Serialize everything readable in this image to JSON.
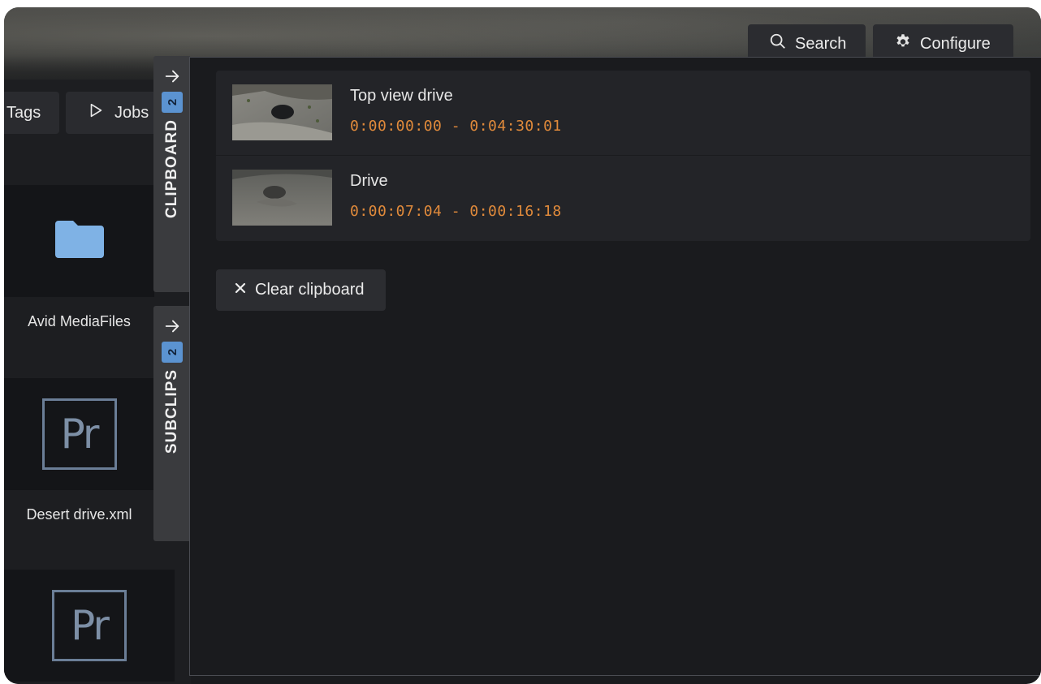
{
  "header": {
    "search_label": "Search",
    "configure_label": "Configure",
    "search_icon": "search-icon",
    "configure_icon": "gear-icon"
  },
  "browser": {
    "tabs": [
      {
        "label": "Tags"
      },
      {
        "label": "Jobs",
        "icon": "play-icon"
      }
    ],
    "items": [
      {
        "label": "Avid MediaFiles",
        "icon": "folder-icon"
      },
      {
        "label": "Desert drive.xml",
        "icon": "premiere-file-icon",
        "icon_text": "Pr"
      },
      {
        "label": "",
        "icon": "premiere-file-icon",
        "icon_text": "Pr"
      }
    ]
  },
  "side_tabs": [
    {
      "label": "CLIPBOARD",
      "count": "2",
      "icon": "arrow-right-icon"
    },
    {
      "label": "SUBCLIPS",
      "count": "2",
      "icon": "arrow-right-icon"
    }
  ],
  "clipboard": {
    "clips": [
      {
        "title": "Top view drive",
        "timecode": "0:00:00:00 - 0:04:30:01"
      },
      {
        "title": "Drive",
        "timecode": "0:00:07:04 - 0:00:16:18"
      }
    ],
    "clear_label": "Clear clipboard",
    "clear_icon": "close-icon"
  },
  "colors": {
    "accent_timecode": "#e08a3b",
    "badge": "#5b93d1",
    "folder": "#7fb2e5"
  }
}
